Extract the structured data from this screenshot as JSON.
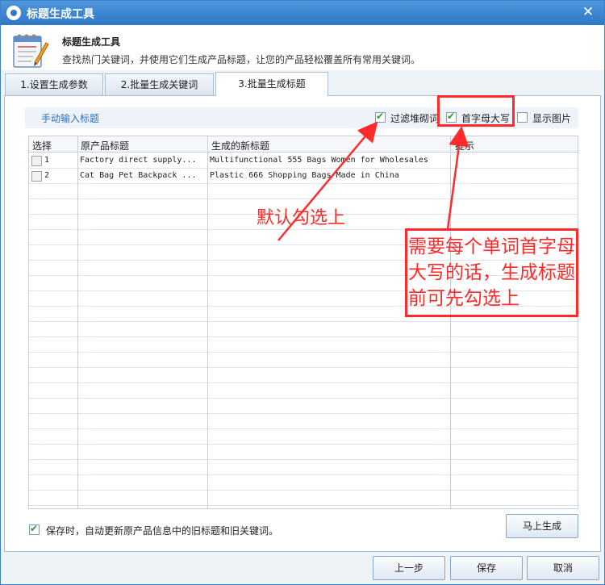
{
  "window": {
    "title": "标题生成工具",
    "close_symbol": "✕"
  },
  "header": {
    "title": "标题生成工具",
    "description": "查找热门关键词，并使用它们生成产品标题，让您的产品轻松覆盖所有常用关键词。"
  },
  "tabs": [
    {
      "label": "1.设置生成参数"
    },
    {
      "label": "2.批量生成关键词"
    },
    {
      "label": "3.批量生成标题"
    }
  ],
  "options": {
    "manual_input_label": "手动输入标题",
    "filter_label": "过滤堆砌词",
    "filter_checked": true,
    "capitalize_label": "首字母大写",
    "capitalize_checked": true,
    "show_images_label": "显示图片",
    "show_images_checked": false
  },
  "table": {
    "columns": [
      "选择",
      "原产品标题",
      "生成的新标题",
      "提示"
    ],
    "rows": [
      {
        "index": "1",
        "original": "Factory direct supply...",
        "generated": "Multifunctional 555 Bags Women for Wholesales",
        "hint": ""
      },
      {
        "index": "2",
        "original": "Cat Bag Pet Backpack ...",
        "generated": "Plastic 666 Shopping Bags Made in China",
        "hint": ""
      }
    ]
  },
  "footer": {
    "auto_update_label": "保存时，自动更新原产品信息中的旧标题和旧关键词。",
    "auto_update_checked": true,
    "generate_button": "马上生成",
    "prev_button": "上一步",
    "save_button": "保存",
    "cancel_button": "取消"
  },
  "annotations": {
    "default_checked": "默认勾选上",
    "capitalize_hint_line1": "需要每个单词首字母",
    "capitalize_hint_line2": "大写的话，生成标题",
    "capitalize_hint_line3": "前可先勾选上"
  },
  "colors": {
    "accent": "#2e77c6",
    "annotation": "#ff2a2a",
    "link": "#2a6fc0"
  }
}
